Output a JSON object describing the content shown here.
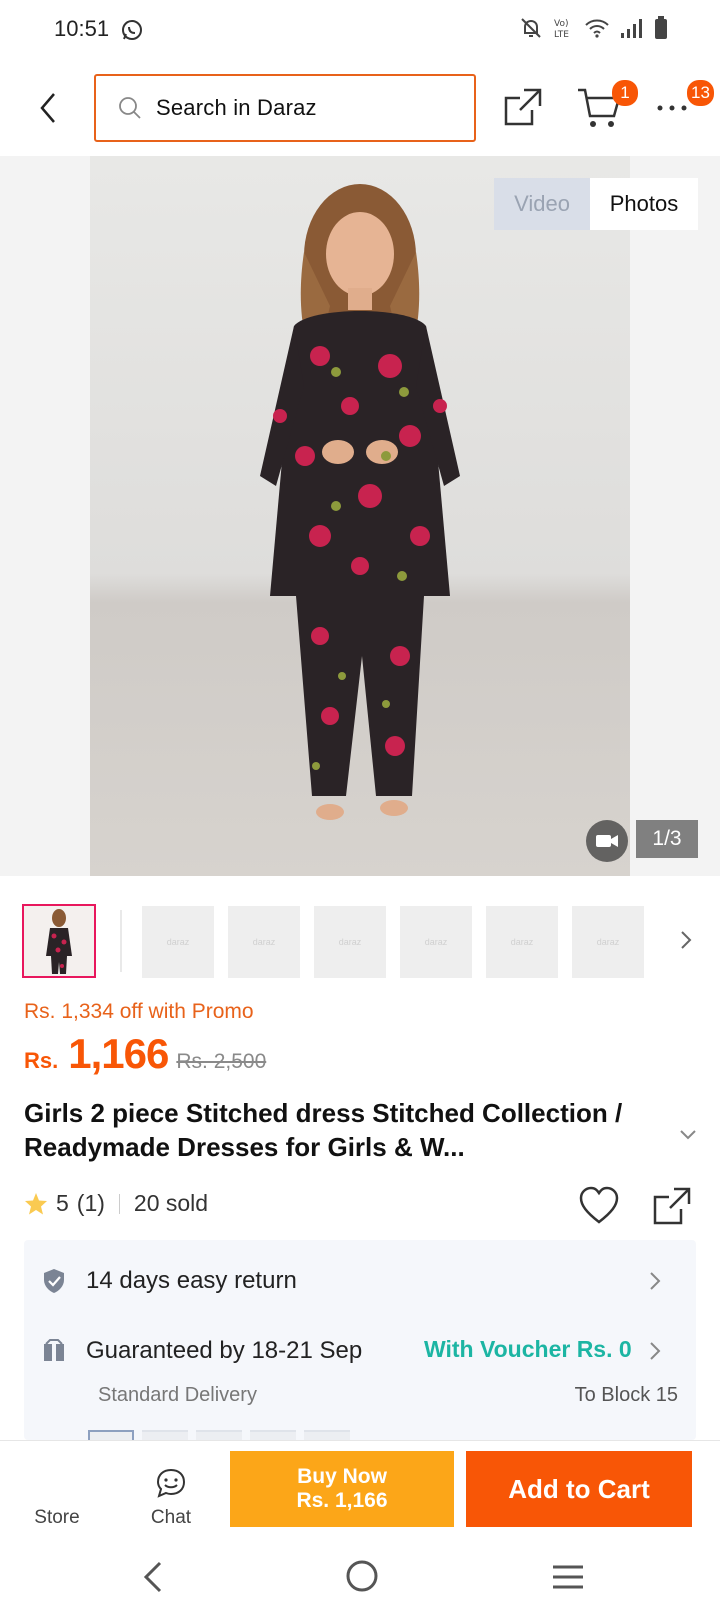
{
  "status_bar": {
    "time": "10:51",
    "icons": [
      "whatsapp-icon",
      "mute-icon",
      "volte-icon",
      "wifi-icon",
      "signal-icon",
      "battery-icon"
    ]
  },
  "header": {
    "search_placeholder": "Search in Daraz",
    "cart_badge": "1",
    "more_badge": "13",
    "accent_color": "#f85606"
  },
  "gallery": {
    "toggle_video": "Video",
    "toggle_photos": "Photos",
    "counter": "1/3",
    "thumb_placeholder": "daraz"
  },
  "product": {
    "promo_text": "Rs. 1,334 off with Promo",
    "currency": "Rs.",
    "price": "1,166",
    "original_price": "Rs. 2,500",
    "title": "Girls 2 piece Stitched dress Stitched Collection / Readymade Dresses for Girls & W...",
    "rating": "5",
    "rating_count": "(1)",
    "sold": "20 sold"
  },
  "services": {
    "return_text": "14 days easy return",
    "delivery_text": "Guaranteed by 18-21 Sep",
    "voucher_text": "With Voucher Rs. 0",
    "delivery_type": "Standard Delivery",
    "destination": "To Block 15"
  },
  "bottom_bar": {
    "store_label": "Store",
    "chat_label": "Chat",
    "buy_now_line1": "Buy Now",
    "buy_now_line2": "Rs. 1,166",
    "add_to_cart": "Add to Cart"
  }
}
